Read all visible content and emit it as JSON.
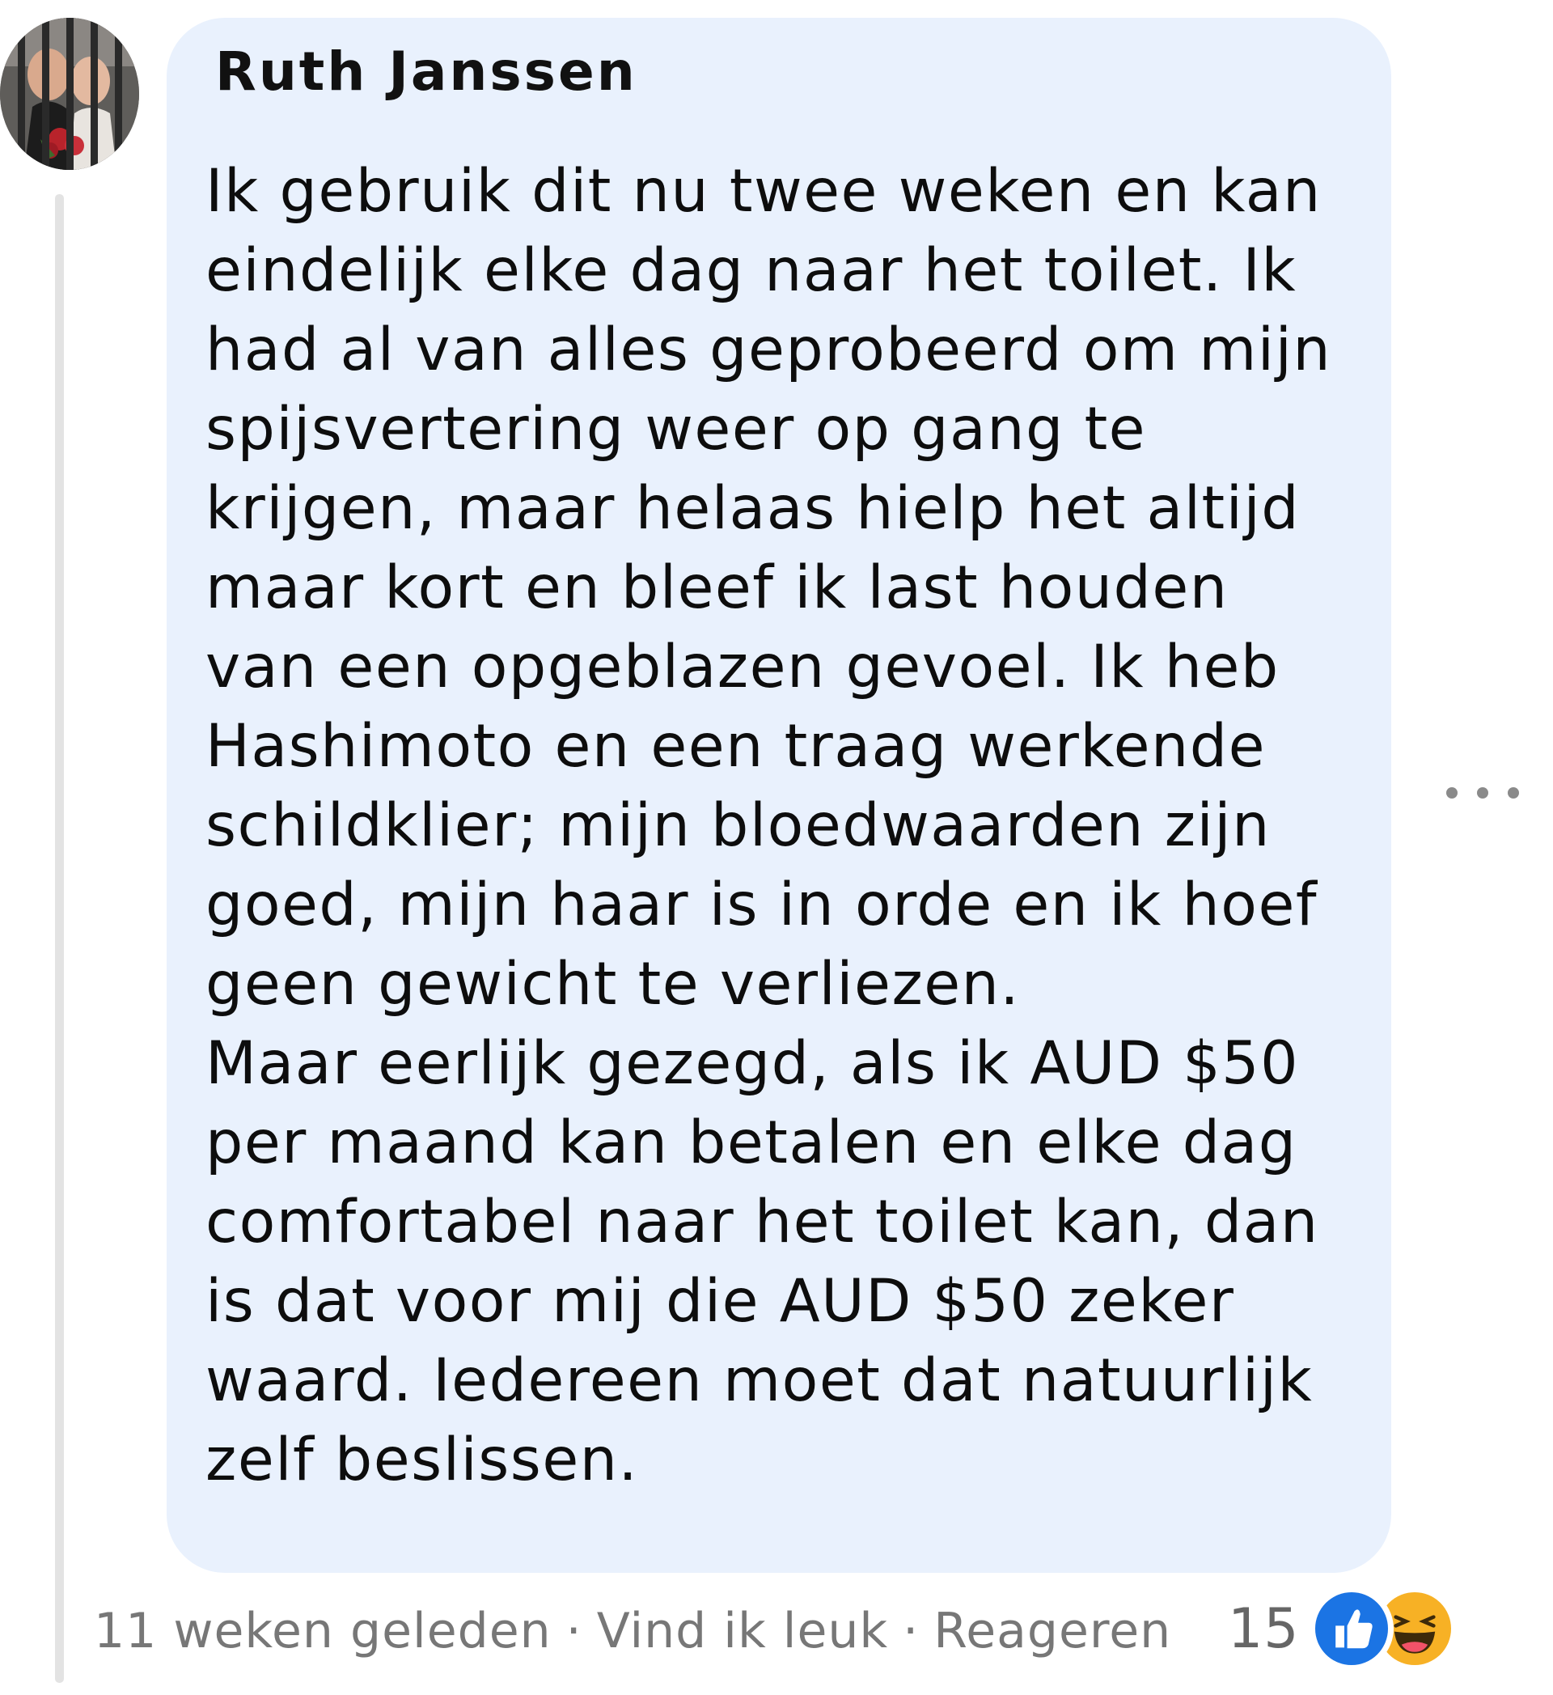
{
  "comment": {
    "author": "Ruth Janssen",
    "lines": [
      "Ik gebruik dit nu twee weken en kan",
      "eindelijk elke dag naar het toilet. Ik",
      "had al van alles geprobeerd om mijn",
      "spijsvertering weer op gang te",
      "krijgen, maar helaas hielp het altijd",
      "maar kort en bleef ik last houden",
      "van een opgeblazen gevoel. Ik heb",
      "Hashimoto en een traag werkende",
      "schildklier; mijn bloedwaarden zijn",
      "goed, mijn haar is in orde en ik hoef",
      "geen gewicht te verliezen.",
      "Maar eerlijk gezegd, als ik AUD $50",
      "per maand kan betalen en elke dag",
      "comfortabel naar het toilet kan, dan",
      "is dat voor mij die AUD $50 zeker",
      "waard. Iedereen moet dat natuurlijk",
      "zelf beslissen."
    ]
  },
  "footer": {
    "time": "11 weken geleden",
    "separator": "·",
    "like_label": "Vind ik leuk",
    "reply_label": "Reageren"
  },
  "reactions": {
    "count": "15",
    "icons": [
      "like-icon",
      "haha-icon"
    ]
  },
  "icons": {
    "more": "more-options-icon"
  },
  "colors": {
    "bubble": "#e9f1fd",
    "like": "#1b74e4",
    "haha": "#f7b125",
    "meta_text": "#777777"
  }
}
